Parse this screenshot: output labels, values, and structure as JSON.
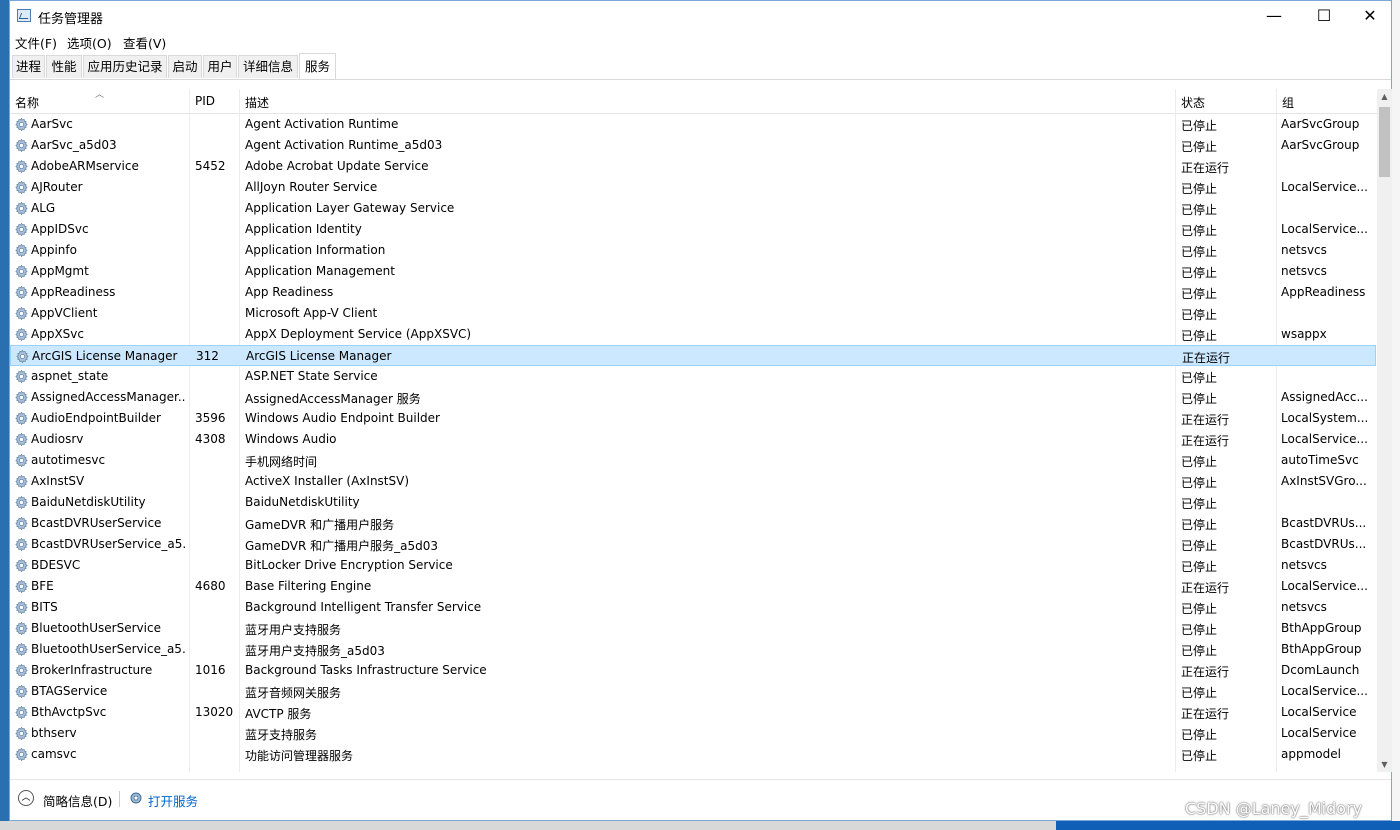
{
  "window": {
    "title": "任务管理器",
    "minimize": "—",
    "maximize": "☐",
    "close": "✕"
  },
  "menu": [
    "文件(F)",
    "选项(O)",
    "查看(V)"
  ],
  "tabs": [
    "进程",
    "性能",
    "应用历史记录",
    "启动",
    "用户",
    "详细信息",
    "服务"
  ],
  "active_tab": 6,
  "columns": {
    "name": "名称",
    "pid": "PID",
    "desc": "描述",
    "status": "状态",
    "group": "组"
  },
  "rows": [
    {
      "name": "AarSvc",
      "pid": "",
      "desc": "Agent Activation Runtime",
      "status": "已停止",
      "group": "AarSvcGroup"
    },
    {
      "name": "AarSvc_a5d03",
      "pid": "",
      "desc": "Agent Activation Runtime_a5d03",
      "status": "已停止",
      "group": "AarSvcGroup"
    },
    {
      "name": "AdobeARMservice",
      "pid": "5452",
      "desc": "Adobe Acrobat Update Service",
      "status": "正在运行",
      "group": ""
    },
    {
      "name": "AJRouter",
      "pid": "",
      "desc": "AllJoyn Router Service",
      "status": "已停止",
      "group": "LocalService..."
    },
    {
      "name": "ALG",
      "pid": "",
      "desc": "Application Layer Gateway Service",
      "status": "已停止",
      "group": ""
    },
    {
      "name": "AppIDSvc",
      "pid": "",
      "desc": "Application Identity",
      "status": "已停止",
      "group": "LocalService..."
    },
    {
      "name": "Appinfo",
      "pid": "",
      "desc": "Application Information",
      "status": "已停止",
      "group": "netsvcs"
    },
    {
      "name": "AppMgmt",
      "pid": "",
      "desc": "Application Management",
      "status": "已停止",
      "group": "netsvcs"
    },
    {
      "name": "AppReadiness",
      "pid": "",
      "desc": "App Readiness",
      "status": "已停止",
      "group": "AppReadiness"
    },
    {
      "name": "AppVClient",
      "pid": "",
      "desc": "Microsoft App-V Client",
      "status": "已停止",
      "group": ""
    },
    {
      "name": "AppXSvc",
      "pid": "",
      "desc": "AppX Deployment Service (AppXSVC)",
      "status": "已停止",
      "group": "wsappx"
    },
    {
      "name": "ArcGIS License Manager",
      "pid": "312",
      "desc": "ArcGIS License Manager",
      "status": "正在运行",
      "group": ""
    },
    {
      "name": "aspnet_state",
      "pid": "",
      "desc": "ASP.NET State Service",
      "status": "已停止",
      "group": ""
    },
    {
      "name": "AssignedAccessManager...",
      "pid": "",
      "desc": "AssignedAccessManager 服务",
      "status": "已停止",
      "group": "AssignedAcc..."
    },
    {
      "name": "AudioEndpointBuilder",
      "pid": "3596",
      "desc": "Windows Audio Endpoint Builder",
      "status": "正在运行",
      "group": "LocalSystem..."
    },
    {
      "name": "Audiosrv",
      "pid": "4308",
      "desc": "Windows Audio",
      "status": "正在运行",
      "group": "LocalService..."
    },
    {
      "name": "autotimesvc",
      "pid": "",
      "desc": "手机网络时间",
      "status": "已停止",
      "group": "autoTimeSvc"
    },
    {
      "name": "AxInstSV",
      "pid": "",
      "desc": "ActiveX Installer (AxInstSV)",
      "status": "已停止",
      "group": "AxInstSVGro..."
    },
    {
      "name": "BaiduNetdiskUtility",
      "pid": "",
      "desc": "BaiduNetdiskUtility",
      "status": "已停止",
      "group": ""
    },
    {
      "name": "BcastDVRUserService",
      "pid": "",
      "desc": "GameDVR 和广播用户服务",
      "status": "已停止",
      "group": "BcastDVRUs..."
    },
    {
      "name": "BcastDVRUserService_a5...",
      "pid": "",
      "desc": "GameDVR 和广播用户服务_a5d03",
      "status": "已停止",
      "group": "BcastDVRUs..."
    },
    {
      "name": "BDESVC",
      "pid": "",
      "desc": "BitLocker Drive Encryption Service",
      "status": "已停止",
      "group": "netsvcs"
    },
    {
      "name": "BFE",
      "pid": "4680",
      "desc": "Base Filtering Engine",
      "status": "正在运行",
      "group": "LocalService..."
    },
    {
      "name": "BITS",
      "pid": "",
      "desc": "Background Intelligent Transfer Service",
      "status": "已停止",
      "group": "netsvcs"
    },
    {
      "name": "BluetoothUserService",
      "pid": "",
      "desc": "蓝牙用户支持服务",
      "status": "已停止",
      "group": "BthAppGroup"
    },
    {
      "name": "BluetoothUserService_a5...",
      "pid": "",
      "desc": "蓝牙用户支持服务_a5d03",
      "status": "已停止",
      "group": "BthAppGroup"
    },
    {
      "name": "BrokerInfrastructure",
      "pid": "1016",
      "desc": "Background Tasks Infrastructure Service",
      "status": "正在运行",
      "group": "DcomLaunch"
    },
    {
      "name": "BTAGService",
      "pid": "",
      "desc": "蓝牙音频网关服务",
      "status": "已停止",
      "group": "LocalService..."
    },
    {
      "name": "BthAvctpSvc",
      "pid": "13020",
      "desc": "AVCTP 服务",
      "status": "正在运行",
      "group": "LocalService"
    },
    {
      "name": "bthserv",
      "pid": "",
      "desc": "蓝牙支持服务",
      "status": "已停止",
      "group": "LocalService"
    },
    {
      "name": "camsvc",
      "pid": "",
      "desc": "功能访问管理器服务",
      "status": "已停止",
      "group": "appmodel"
    }
  ],
  "selected_row": 11,
  "footer": {
    "fewer_details": "简略信息(D)",
    "open_services": "打开服务"
  },
  "watermark": "CSDN @Laney_Midory",
  "colors": {
    "selection": "#cce8ff",
    "link": "#0066cc"
  }
}
